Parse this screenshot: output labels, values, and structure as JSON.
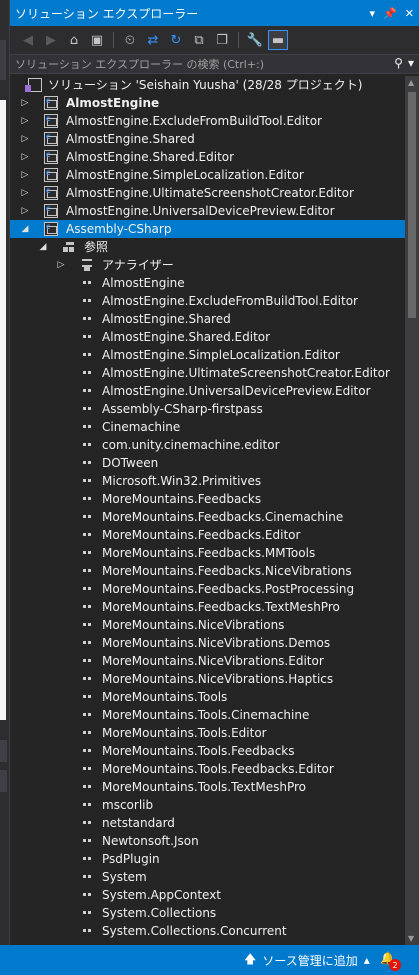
{
  "panel": {
    "title": "ソリューション エクスプローラー",
    "title_icons": [
      "pin-icon",
      "dropdown-icon",
      "close-icon"
    ]
  },
  "toolbar": {
    "buttons": [
      "back-icon",
      "forward-icon",
      "home-icon",
      "switch-views-icon",
      "history-icon",
      "sync-icon",
      "refresh-icon",
      "collapse-all-icon",
      "show-all-files-icon",
      "properties-icon",
      "preview-icon"
    ]
  },
  "search": {
    "placeholder": "ソリューション エクスプローラー の検索 (Ctrl+:)",
    "value": ""
  },
  "tree": {
    "solution": "ソリューション 'Seishain Yuusha' (28/28 プロジェクト)",
    "projects": [
      "AlmostEngine",
      "AlmostEngine.ExcludeFromBuildTool.Editor",
      "AlmostEngine.Shared",
      "AlmostEngine.Shared.Editor",
      "AlmostEngine.SimpleLocalization.Editor",
      "AlmostEngine.UltimateScreenshotCreator.Editor",
      "AlmostEngine.UniversalDevicePreview.Editor",
      "Assembly-CSharp"
    ],
    "selected_project": "Assembly-CSharp",
    "references_label": "参照",
    "analyzers_label": "アナライザー",
    "references": [
      "AlmostEngine",
      "AlmostEngine.ExcludeFromBuildTool.Editor",
      "AlmostEngine.Shared",
      "AlmostEngine.Shared.Editor",
      "AlmostEngine.SimpleLocalization.Editor",
      "AlmostEngine.UltimateScreenshotCreator.Editor",
      "AlmostEngine.UniversalDevicePreview.Editor",
      "Assembly-CSharp-firstpass",
      "Cinemachine",
      "com.unity.cinemachine.editor",
      "DOTween",
      "Microsoft.Win32.Primitives",
      "MoreMountains.Feedbacks",
      "MoreMountains.Feedbacks.Cinemachine",
      "MoreMountains.Feedbacks.Editor",
      "MoreMountains.Feedbacks.MMTools",
      "MoreMountains.Feedbacks.NiceVibrations",
      "MoreMountains.Feedbacks.PostProcessing",
      "MoreMountains.Feedbacks.TextMeshPro",
      "MoreMountains.NiceVibrations",
      "MoreMountains.NiceVibrations.Demos",
      "MoreMountains.NiceVibrations.Editor",
      "MoreMountains.NiceVibrations.Haptics",
      "MoreMountains.Tools",
      "MoreMountains.Tools.Cinemachine",
      "MoreMountains.Tools.Editor",
      "MoreMountains.Tools.Feedbacks",
      "MoreMountains.Tools.Feedbacks.Editor",
      "MoreMountains.Tools.TextMeshPro",
      "mscorlib",
      "netstandard",
      "Newtonsoft.Json",
      "PsdPlugin",
      "System",
      "System.AppContext",
      "System.Collections",
      "System.Collections.Concurrent"
    ]
  },
  "statusbar": {
    "source_control": "ソース管理に追加",
    "notification_count": "2"
  },
  "colors": {
    "accent": "#007acc",
    "panel_bg": "#252526",
    "text": "#f1f1f1"
  }
}
